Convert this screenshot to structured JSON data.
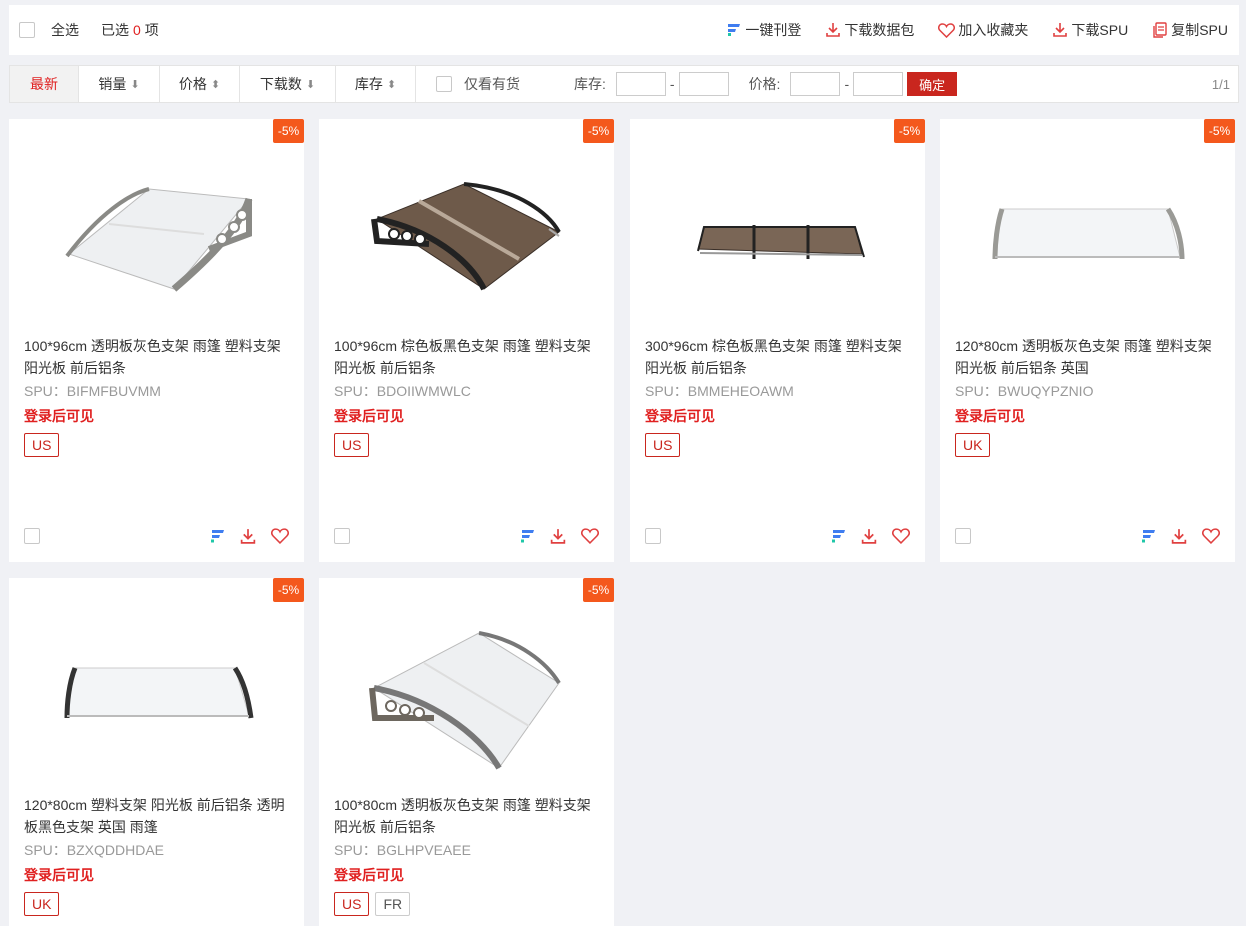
{
  "topbar": {
    "select_all": "全选",
    "selected_prefix": "已选",
    "selected_count": "0",
    "selected_suffix": "项",
    "actions": [
      {
        "label": "一键刊登",
        "icon": "publish-icon"
      },
      {
        "label": "下载数据包",
        "icon": "download-icon"
      },
      {
        "label": "加入收藏夹",
        "icon": "heart-icon"
      },
      {
        "label": "下载SPU",
        "icon": "download-icon"
      },
      {
        "label": "复制SPU",
        "icon": "copy-icon"
      }
    ]
  },
  "filter": {
    "sorts": [
      {
        "label": "最新",
        "arrow": ""
      },
      {
        "label": "销量",
        "arrow": "⬇"
      },
      {
        "label": "价格",
        "arrow": "⬍"
      },
      {
        "label": "下载数",
        "arrow": "⬇"
      },
      {
        "label": "库存",
        "arrow": "⬍"
      }
    ],
    "only_in_stock": "仅看有货",
    "stock_label": "库存:",
    "price_label": "价格:",
    "dash": "-",
    "confirm": "确定",
    "pager": "1/1"
  },
  "login_text": "登录后可见",
  "products": [
    {
      "title": "100*96cm 透明板灰色支架 雨篷 塑料支架 阳光板 前后铝条",
      "spu": "SPU：BIFMFBUVMM",
      "discount": "-5%",
      "tags": [
        "US"
      ],
      "image": "clear-awning-gray-brackets"
    },
    {
      "title": "100*96cm 棕色板黑色支架 雨篷 塑料支架 阳光板 前后铝条",
      "spu": "SPU：BDOIIWMWLC",
      "discount": "-5%",
      "tags": [
        "US"
      ],
      "image": "brown-awning-black-brackets"
    },
    {
      "title": "300*96cm 棕色板黑色支架 雨篷 塑料支架 阳光板 前后铝条",
      "spu": "SPU：BMMEHEOAWM",
      "discount": "-5%",
      "tags": [
        "US"
      ],
      "image": "long-brown-awning"
    },
    {
      "title": "120*80cm 透明板灰色支架 雨篷 塑料支架 阳光板 前后铝条 英国",
      "spu": "SPU：BWUQYPZNIO",
      "discount": "-5%",
      "tags": [
        "UK"
      ],
      "image": "clear-awning-front-gray"
    },
    {
      "title": "120*80cm 塑料支架 阳光板 前后铝条 透明板黑色支架 英国 雨篷",
      "spu": "SPU：BZXQDDHDAE",
      "discount": "-5%",
      "tags": [
        "UK"
      ],
      "image": "clear-awning-front-black"
    },
    {
      "title": "100*80cm 透明板灰色支架 雨篷 塑料支架 阳光板 前后铝条",
      "spu": "SPU：BGLHPVEAEE",
      "discount": "-5%",
      "tags": [
        "US",
        "FR"
      ],
      "image": "clear-awning-side-gray"
    }
  ],
  "colors": {
    "accent": "#c9261e",
    "badge": "#f4581c",
    "price_red": "#e02020"
  }
}
